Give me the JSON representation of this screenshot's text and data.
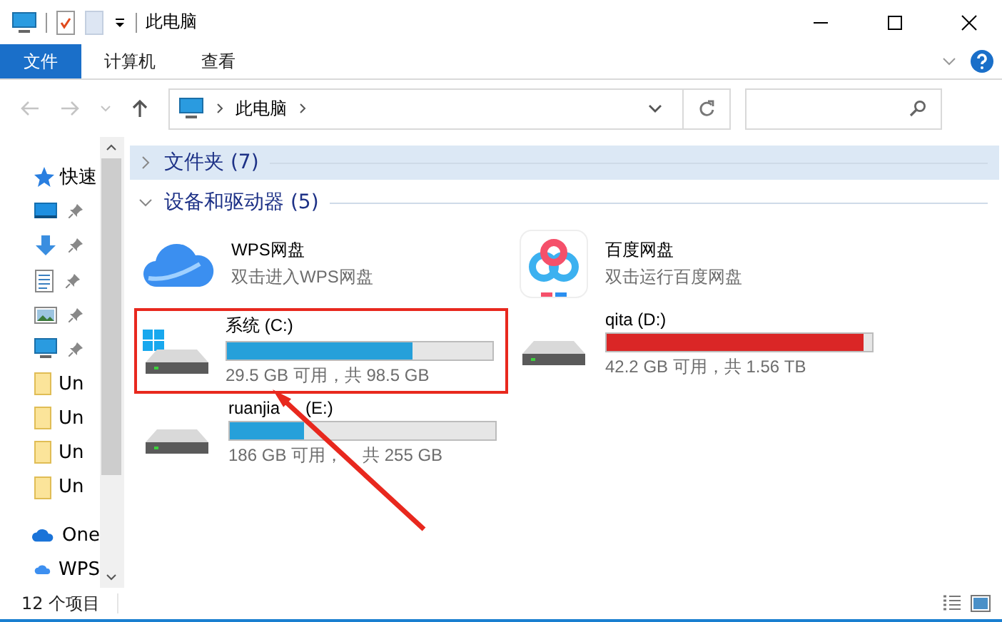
{
  "window": {
    "title": "此电脑"
  },
  "ribbon_tabs": [
    {
      "label": "文件",
      "selected": true
    },
    {
      "label": "计算机",
      "selected": false
    },
    {
      "label": "查看",
      "selected": false
    }
  ],
  "address": {
    "path": "此电脑"
  },
  "sidebar": {
    "items": [
      {
        "label": "快速",
        "kind": "star",
        "pinned": false
      },
      {
        "kind": "desktop",
        "pinned": true
      },
      {
        "kind": "download",
        "pinned": true
      },
      {
        "kind": "document",
        "pinned": true
      },
      {
        "kind": "pictures",
        "pinned": true
      },
      {
        "kind": "computer",
        "pinned": true
      },
      {
        "label": "Un",
        "kind": "folder",
        "pinned": false
      },
      {
        "label": "Un",
        "kind": "folder",
        "pinned": false
      },
      {
        "label": "Un",
        "kind": "folder",
        "pinned": false
      },
      {
        "label": "Un",
        "kind": "folder",
        "pinned": false
      },
      {
        "label": "One",
        "kind": "onedrive",
        "pinned": false
      },
      {
        "label": "WPS",
        "kind": "wps",
        "pinned": false
      }
    ]
  },
  "groups": [
    {
      "title": "文件夹 (7)",
      "expanded": false,
      "selected": true
    },
    {
      "title": "设备和驱动器 (5)",
      "expanded": true,
      "selected": false,
      "items": [
        {
          "kind": "app",
          "name": "WPS网盘",
          "subtitle": "双击进入WPS网盘"
        },
        {
          "kind": "app",
          "name": "百度网盘",
          "subtitle": "双击运行百度网盘"
        },
        {
          "kind": "drive",
          "system": true,
          "name": "系统 (C:)",
          "level": 0.7,
          "color": "#26a0da",
          "usage": "29.5 GB 可用，共 98.5 GB",
          "highlighted": true
        },
        {
          "kind": "drive",
          "system": false,
          "name": "qita (D:)",
          "level": 0.97,
          "color": "#da2626",
          "usage": "42.2 GB 可用，共 1.56 TB",
          "highlighted": false
        },
        {
          "kind": "drive",
          "system": false,
          "name": "ruanjia",
          "name_suffix": "(E:)",
          "level": 0.28,
          "color": "#26a0da",
          "usage": "186 GB 可用，",
          "usage_suffix": "共 255 GB",
          "highlighted": false
        }
      ]
    }
  ],
  "status_bar": {
    "count": "12 个项目"
  }
}
